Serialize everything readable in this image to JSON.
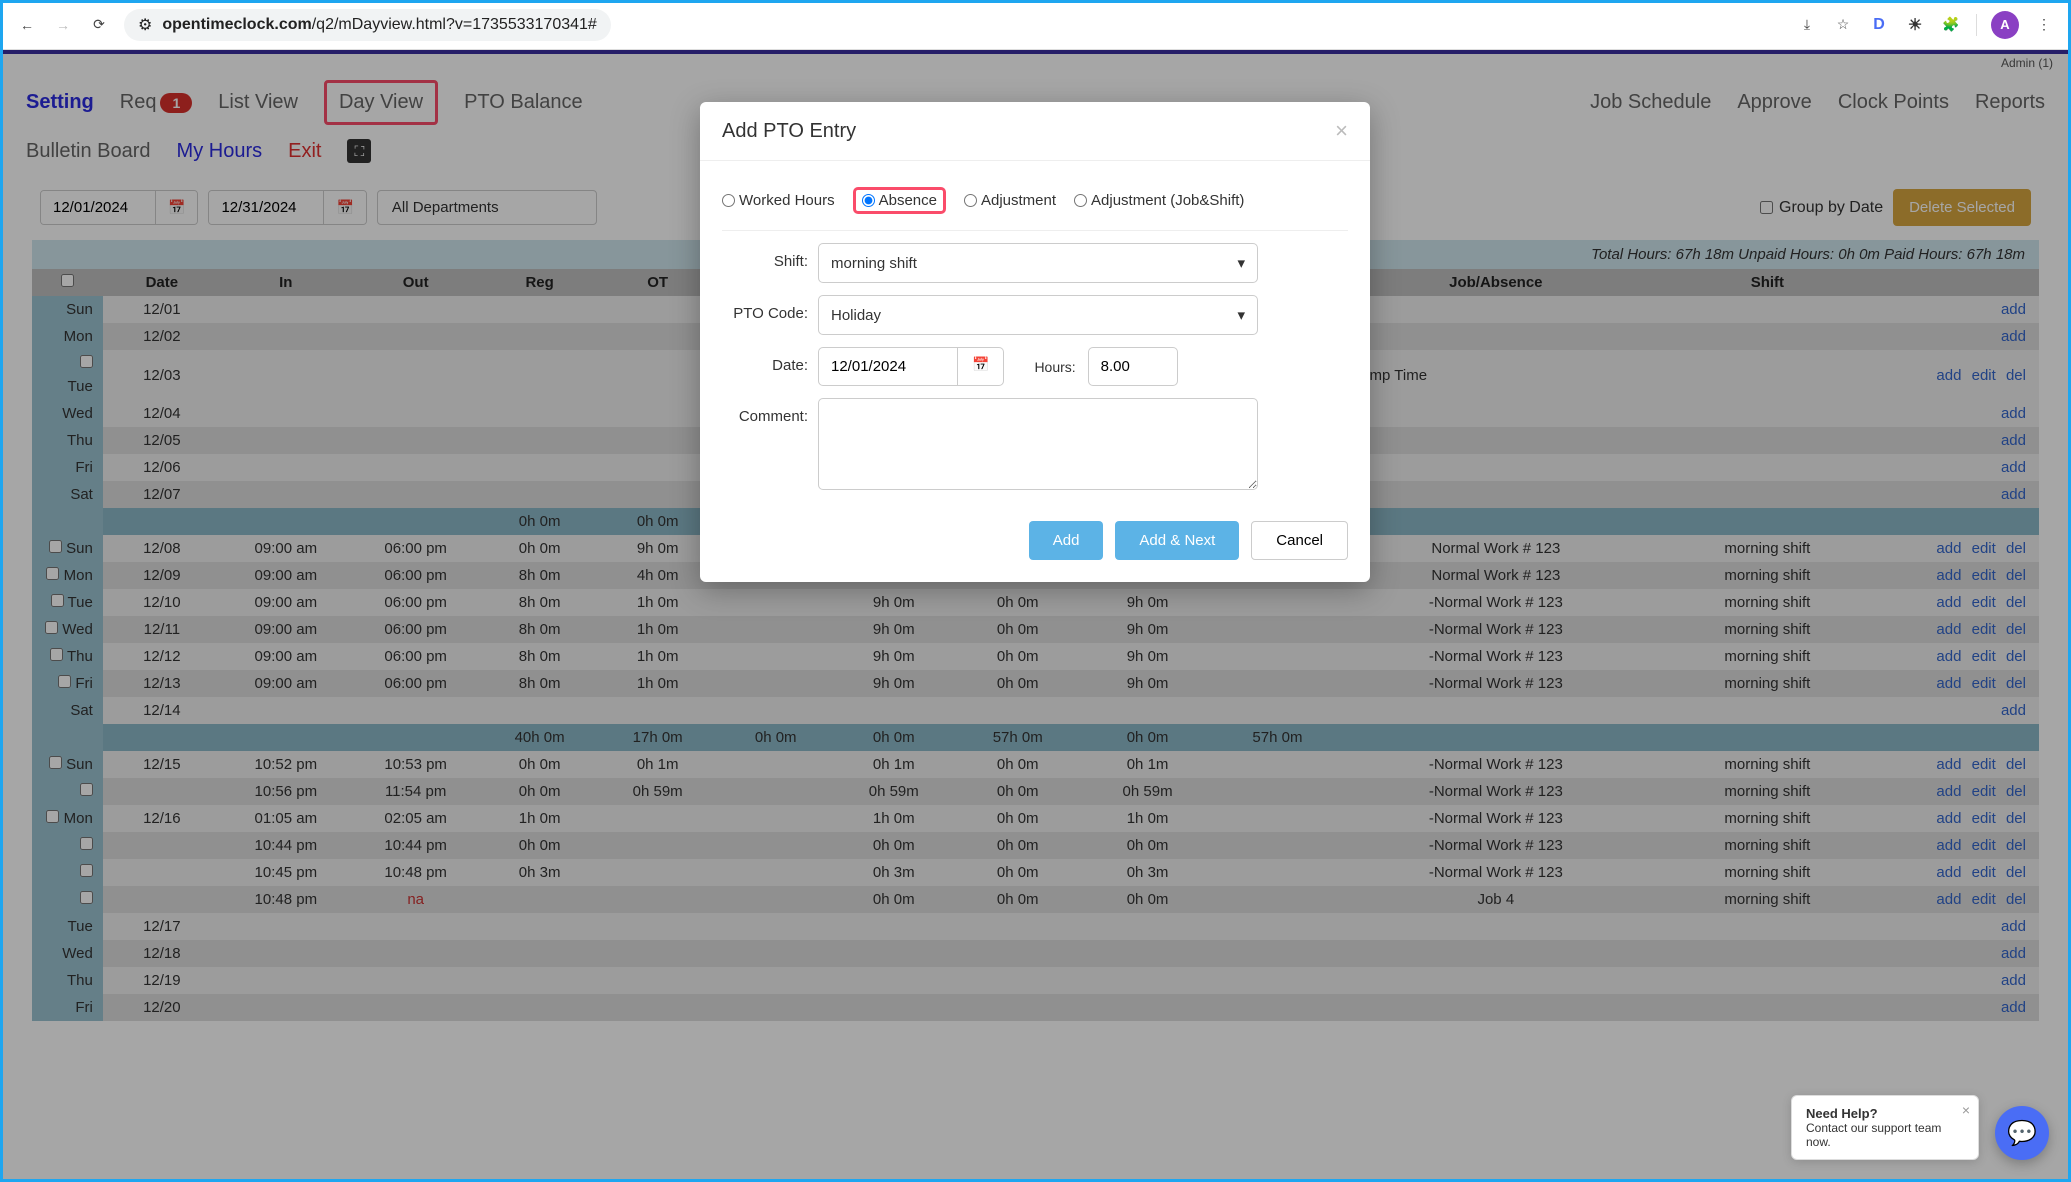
{
  "browser": {
    "url_host": "opentimeclock.com",
    "url_path": "/q2/mDayview.html?v=1735533170341#",
    "profile_initial": "A",
    "ext_d": "D"
  },
  "admin_label": "Admin (1)",
  "nav": {
    "setting": "Setting",
    "req": "Req",
    "req_badge": "1",
    "list_view": "List View",
    "day_view": "Day View",
    "pto_balance": "PTO Balance",
    "job_schedule": "Job Schedule",
    "approve": "Approve",
    "clock_points": "Clock Points",
    "reports": "Reports"
  },
  "subnav": {
    "bulletin": "Bulletin Board",
    "my_hours": "My Hours",
    "exit": "Exit"
  },
  "filters": {
    "from": "12/01/2024",
    "to": "12/31/2024",
    "dept": "All Departments",
    "group_by": "Group by Date",
    "delete_selected": "Delete Selected"
  },
  "totals": "Total Hours: 67h 18m Unpaid Hours: 0h 0m Paid Hours: 67h 18m",
  "headers": [
    "",
    "Date",
    "In",
    "Out",
    "Reg",
    "OT",
    "",
    "",
    "",
    "",
    "",
    "Job/Absence",
    "Shift",
    ""
  ],
  "actions": {
    "add": "add",
    "edit": "edit",
    "del": "del"
  },
  "rows": [
    {
      "day": "Sun",
      "date": "12/08",
      "in": "09:00 am",
      "out": "06:00 pm",
      "reg": "0h 0m",
      "ot": "9h 0m",
      "c7": "",
      "c8": "",
      "c9": "",
      "c10": "",
      "c11": "",
      "job": "Normal Work # 123",
      "shift": "morning shift",
      "actions": [
        "add",
        "edit",
        "del"
      ],
      "chk": true,
      "cls": "stripe-odd"
    },
    {
      "day": "Mon",
      "date": "12/09",
      "in": "09:00 am",
      "out": "06:00 pm",
      "reg": "8h 0m",
      "ot": "4h 0m",
      "c7": "",
      "c8": "",
      "c9": "",
      "c10": "",
      "c11": "",
      "job": "Normal Work # 123",
      "shift": "morning shift",
      "actions": [
        "add",
        "edit",
        "del"
      ],
      "chk": true,
      "cls": "stripe-even"
    },
    {
      "day": "Tue",
      "date": "12/10",
      "in": "09:00 am",
      "out": "06:00 pm",
      "reg": "8h 0m",
      "ot": "1h 0m",
      "c7": "",
      "c8": "9h 0m",
      "c9": "0h 0m",
      "c10": "9h 0m",
      "c11": "",
      "job": "-Normal Work # 123",
      "shift": "morning shift",
      "actions": [
        "add",
        "edit",
        "del"
      ],
      "chk": true,
      "cls": "stripe-odd"
    },
    {
      "day": "Wed",
      "date": "12/11",
      "in": "09:00 am",
      "out": "06:00 pm",
      "reg": "8h 0m",
      "ot": "1h 0m",
      "c7": "",
      "c8": "9h 0m",
      "c9": "0h 0m",
      "c10": "9h 0m",
      "c11": "",
      "job": "-Normal Work # 123",
      "shift": "morning shift",
      "actions": [
        "add",
        "edit",
        "del"
      ],
      "chk": true,
      "cls": "stripe-even"
    },
    {
      "day": "Thu",
      "date": "12/12",
      "in": "09:00 am",
      "out": "06:00 pm",
      "reg": "8h 0m",
      "ot": "1h 0m",
      "c7": "",
      "c8": "9h 0m",
      "c9": "0h 0m",
      "c10": "9h 0m",
      "c11": "",
      "job": "-Normal Work # 123",
      "shift": "morning shift",
      "actions": [
        "add",
        "edit",
        "del"
      ],
      "chk": true,
      "cls": "stripe-odd"
    },
    {
      "day": "Fri",
      "date": "12/13",
      "in": "09:00 am",
      "out": "06:00 pm",
      "reg": "8h 0m",
      "ot": "1h 0m",
      "c7": "",
      "c8": "9h 0m",
      "c9": "0h 0m",
      "c10": "9h 0m",
      "c11": "",
      "job": "-Normal Work # 123",
      "shift": "morning shift",
      "actions": [
        "add",
        "edit",
        "del"
      ],
      "chk": true,
      "cls": "stripe-even"
    },
    {
      "day": "Sat",
      "date": "12/14",
      "in": "",
      "out": "",
      "reg": "",
      "ot": "",
      "c7": "",
      "c8": "",
      "c9": "",
      "c10": "",
      "c11": "",
      "job": "",
      "shift": "",
      "actions": [
        "add"
      ],
      "chk": false,
      "cls": "stripe-odd"
    }
  ],
  "pre_rows": [
    {
      "day": "Sun",
      "date": "12/01",
      "chk": false,
      "cls": "stripe-odd",
      "actions": [
        "add"
      ]
    },
    {
      "day": "Mon",
      "date": "12/02",
      "chk": false,
      "cls": "stripe-even",
      "actions": [
        "add"
      ]
    }
  ],
  "tue_row": {
    "day": "Tue",
    "date": "12/03",
    "job": "Comp Time",
    "actions": [
      "add",
      "edit",
      "del"
    ],
    "chk": true
  },
  "post_tue": [
    {
      "day": "Wed",
      "date": "12/04",
      "chk": false,
      "cls": "stripe-odd",
      "actions": [
        "add"
      ]
    },
    {
      "day": "Thu",
      "date": "12/05",
      "chk": false,
      "cls": "stripe-even",
      "actions": [
        "add"
      ]
    },
    {
      "day": "Fri",
      "date": "12/06",
      "chk": false,
      "cls": "stripe-odd",
      "actions": [
        "add"
      ]
    },
    {
      "day": "Sat",
      "date": "12/07",
      "chk": false,
      "cls": "stripe-even",
      "actions": [
        "add"
      ]
    }
  ],
  "subtotal1": {
    "reg": "0h 0m",
    "ot": "0h 0m"
  },
  "subtotal2": {
    "reg": "40h 0m",
    "ot": "17h 0m",
    "c7": "0h 0m",
    "c8": "0h 0m",
    "c9": "57h 0m",
    "c10": "0h 0m",
    "c11": "57h 0m"
  },
  "rows2": [
    {
      "day": "Sun",
      "date": "12/15",
      "in": "10:52 pm",
      "out": "10:53 pm",
      "reg": "0h 0m",
      "ot": "0h 1m",
      "c7": "",
      "c8": "0h 1m",
      "c9": "0h 0m",
      "c10": "0h 1m",
      "c11": "",
      "job": "-Normal Work # 123",
      "shift": "morning shift",
      "actions": [
        "add",
        "edit",
        "del"
      ],
      "chk": true,
      "cls": "stripe-odd"
    },
    {
      "day": "",
      "date": "",
      "in": "10:56 pm",
      "out": "11:54 pm",
      "reg": "0h 0m",
      "ot": "0h 59m",
      "c7": "",
      "c8": "0h 59m",
      "c9": "0h 0m",
      "c10": "0h 59m",
      "c11": "",
      "job": "-Normal Work # 123",
      "shift": "morning shift",
      "actions": [
        "add",
        "edit",
        "del"
      ],
      "chk": true,
      "cls": "stripe-even"
    },
    {
      "day": "Mon",
      "date": "12/16",
      "in": "01:05 am",
      "out": "02:05 am",
      "reg": "1h 0m",
      "ot": "",
      "c7": "",
      "c8": "1h 0m",
      "c9": "0h 0m",
      "c10": "1h 0m",
      "c11": "",
      "job": "-Normal Work # 123",
      "shift": "morning shift",
      "actions": [
        "add",
        "edit",
        "del"
      ],
      "chk": true,
      "cls": "stripe-odd"
    },
    {
      "day": "",
      "date": "",
      "in": "10:44 pm",
      "out": "10:44 pm",
      "reg": "0h 0m",
      "ot": "",
      "c7": "",
      "c8": "0h 0m",
      "c9": "0h 0m",
      "c10": "0h 0m",
      "c11": "",
      "job": "-Normal Work # 123",
      "shift": "morning shift",
      "actions": [
        "add",
        "edit",
        "del"
      ],
      "chk": true,
      "cls": "stripe-even"
    },
    {
      "day": "",
      "date": "",
      "in": "10:45 pm",
      "out": "10:48 pm",
      "reg": "0h 3m",
      "ot": "",
      "c7": "",
      "c8": "0h 3m",
      "c9": "0h 0m",
      "c10": "0h 3m",
      "c11": "",
      "job": "-Normal Work # 123",
      "shift": "morning shift",
      "actions": [
        "add",
        "edit",
        "del"
      ],
      "chk": true,
      "cls": "stripe-odd"
    },
    {
      "day": "",
      "date": "",
      "in": "10:48 pm",
      "out": "na",
      "reg": "",
      "ot": "",
      "c7": "",
      "c8": "0h 0m",
      "c9": "0h 0m",
      "c10": "0h 0m",
      "c11": "",
      "job": "Job 4",
      "shift": "morning shift",
      "actions": [
        "add",
        "edit",
        "del"
      ],
      "chk": true,
      "cls": "stripe-even",
      "na_out": true
    }
  ],
  "rows3": [
    {
      "day": "Tue",
      "date": "12/17",
      "chk": false,
      "cls": "stripe-odd",
      "actions": [
        "add"
      ]
    },
    {
      "day": "Wed",
      "date": "12/18",
      "chk": false,
      "cls": "stripe-even",
      "actions": [
        "add"
      ]
    },
    {
      "day": "Thu",
      "date": "12/19",
      "chk": false,
      "cls": "stripe-odd",
      "actions": [
        "add"
      ]
    },
    {
      "day": "Fri",
      "date": "12/20",
      "chk": false,
      "cls": "stripe-even",
      "actions": [
        "add"
      ]
    }
  ],
  "modal": {
    "title": "Add PTO Entry",
    "radios": {
      "worked": "Worked Hours",
      "absence": "Absence",
      "adjustment": "Adjustment",
      "adjustment_js": "Adjustment (Job&Shift)"
    },
    "shift_label": "Shift:",
    "shift_value": "morning shift",
    "pto_code_label": "PTO Code:",
    "pto_code_value": "Holiday",
    "date_label": "Date:",
    "date_value": "12/01/2024",
    "hours_label": "Hours:",
    "hours_value": "8.00",
    "comment_label": "Comment:",
    "btn_add": "Add",
    "btn_add_next": "Add & Next",
    "btn_cancel": "Cancel"
  },
  "help": {
    "title": "Need Help?",
    "sub": "Contact our support team now."
  }
}
